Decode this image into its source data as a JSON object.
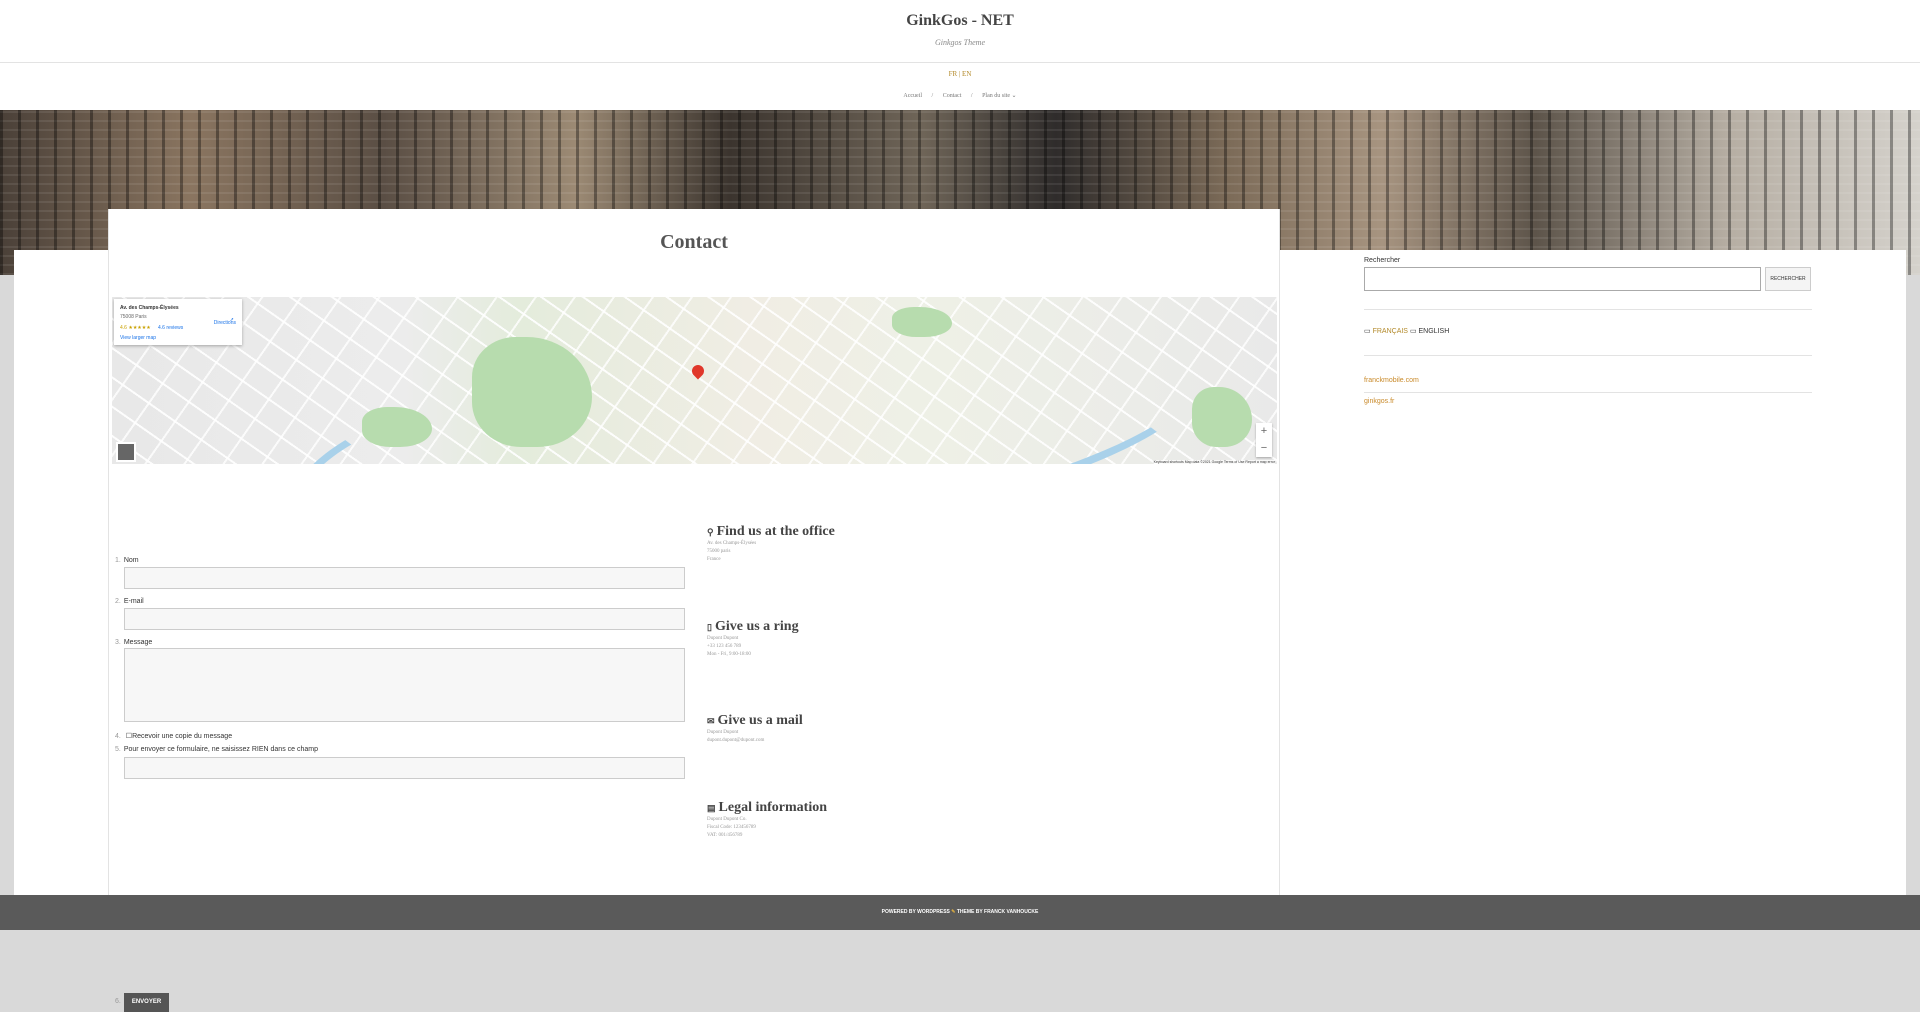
{
  "site": {
    "title": "GinkGos - NET",
    "description": "Ginkgos Theme"
  },
  "header": {
    "lang_switch": "FR | EN"
  },
  "nav": {
    "items": [
      "Accueil",
      "Contact",
      "Plan du site ⌄"
    ],
    "separator": "/"
  },
  "page": {
    "title": "Contact"
  },
  "map": {
    "place_name": "Av. des Champs-Élysées",
    "place_address": "75008 Paris",
    "rating": "4.6 ★★★★★",
    "reviews": "4.6 reviews",
    "larger_map": "View larger map",
    "directions": "Directions",
    "zoom_in": "+",
    "zoom_out": "−",
    "footer": "Keyboard shortcuts   Map data ©2021 Google   Terms of Use   Report a map error"
  },
  "form": {
    "fields": [
      {
        "num": "1.",
        "label": "Nom"
      },
      {
        "num": "2.",
        "label": "E-mail"
      },
      {
        "num": "3.",
        "label": "Message"
      }
    ],
    "copy_num": "4.",
    "copy_label": "Recevoir une copie du message",
    "honeypot_num": "5.",
    "honeypot_label": "Pour envoyer ce formulaire, ne saisissez RIEN dans ce champ",
    "send_num": "6.",
    "send_label": "ENVOYER"
  },
  "info": [
    {
      "icon": "map-marker-icon",
      "glyph": "⚲",
      "title": "Find us at the office",
      "lines": [
        "Av. des Champs-Élysées",
        "75000 paris",
        "France"
      ]
    },
    {
      "icon": "phone-icon",
      "glyph": "▯",
      "title": "Give us a ring",
      "lines": [
        "Dupont Dupont",
        "+33 123 456 789",
        "Mon - Fri, 9:00-18:00"
      ]
    },
    {
      "icon": "envelope-icon",
      "glyph": "✉",
      "title": "Give us a mail",
      "lines": [
        "Dupont Dupont",
        "dupont.dupont@dupont.com"
      ]
    },
    {
      "icon": "document-icon",
      "glyph": "▤",
      "title": "Legal information",
      "lines": [
        "Dupont Dupont Co.",
        "Fiscal Code: 123456789",
        "VAT: 001/456789"
      ]
    }
  ],
  "sidebar": {
    "search_label": "Rechercher",
    "search_button": "RECHERCHER",
    "lang_fr": "FRANÇAIS",
    "lang_en": "ENGLISH",
    "links": [
      "franckmobile.com",
      "ginkgos.fr"
    ]
  },
  "footer": {
    "left": "POWERED BY WORDPRESS",
    "right": "THEME BY FRANCK VANHOUCKE"
  },
  "colors": {
    "accent": "#b38a2a",
    "link": "#c98a2a",
    "footer_bg": "#5a5a5a",
    "button_bg": "#555555"
  }
}
